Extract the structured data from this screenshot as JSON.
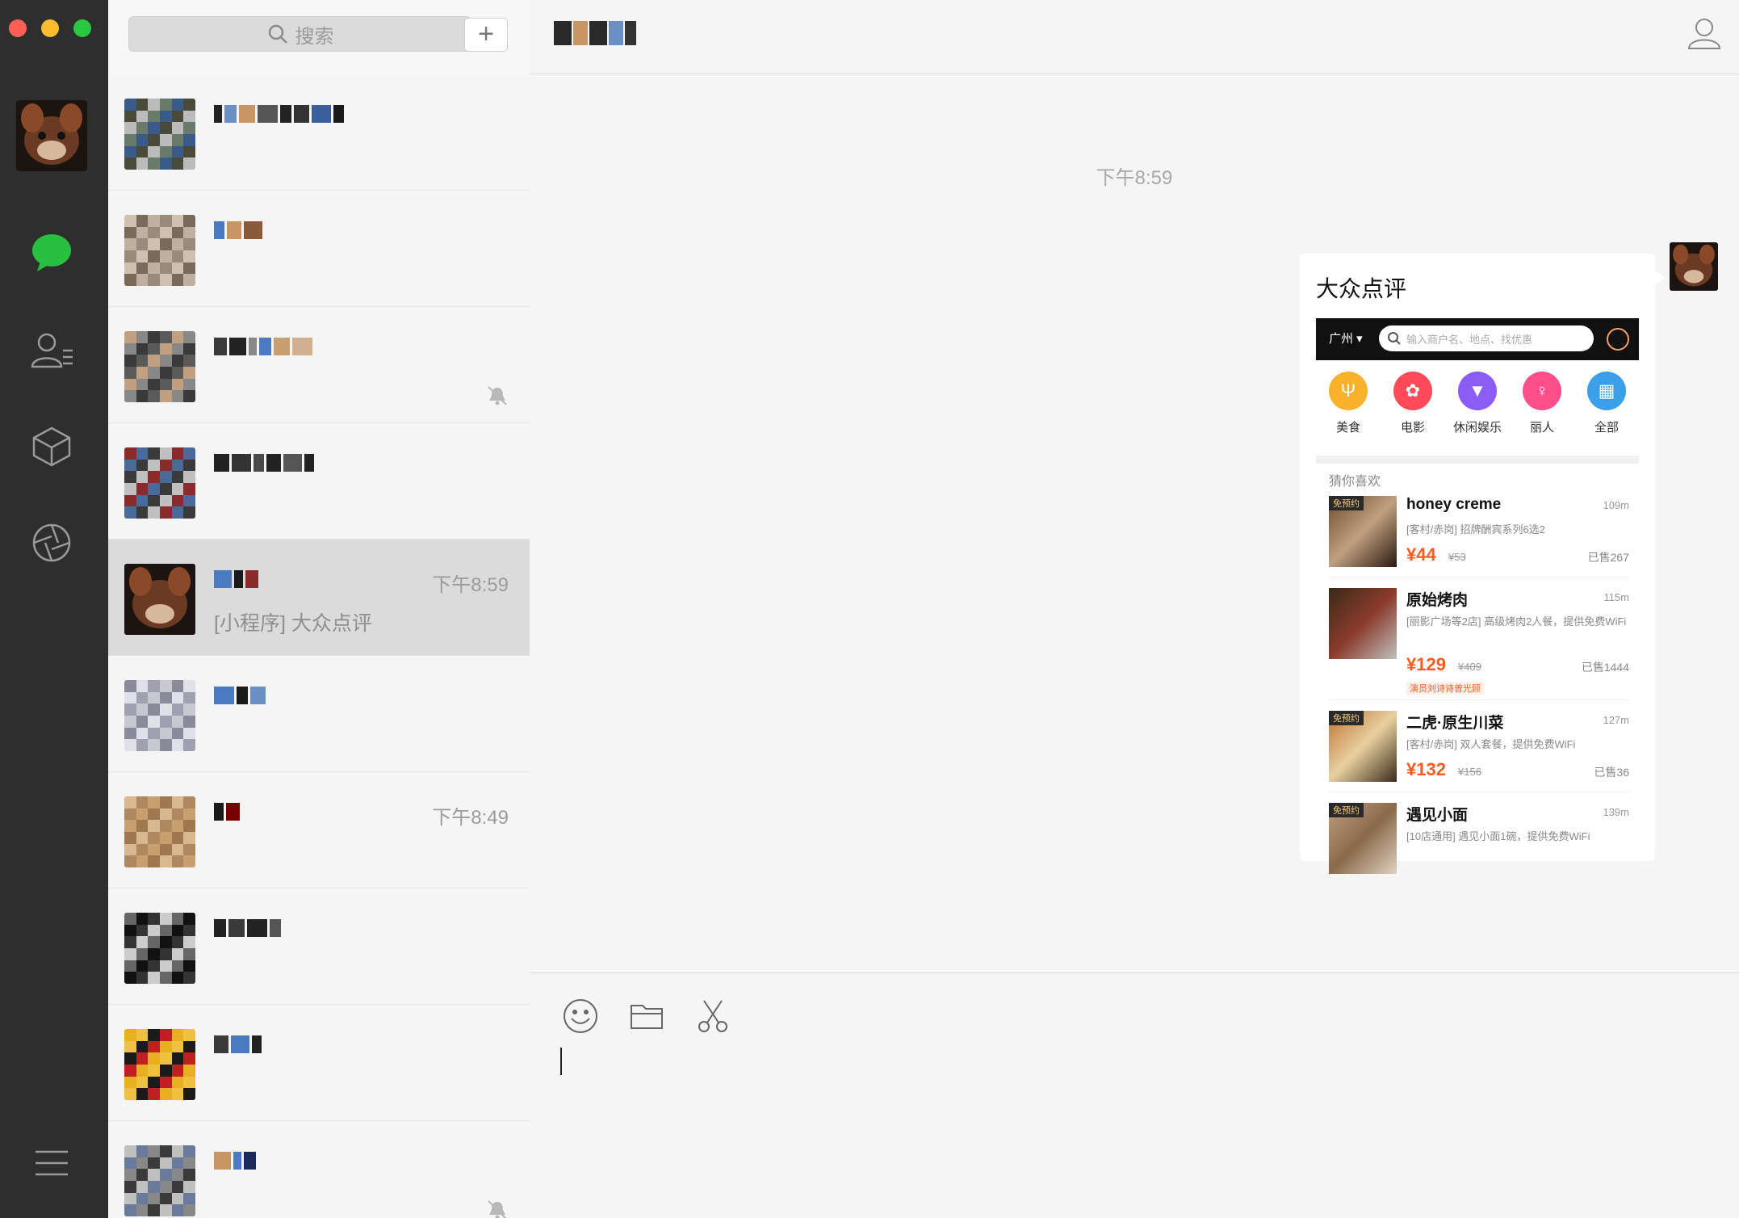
{
  "window": {
    "traffic_lights": [
      "close",
      "minimize",
      "zoom"
    ]
  },
  "rail": {
    "icons": [
      {
        "name": "chat-icon",
        "active": true
      },
      {
        "name": "contacts-icon",
        "active": false
      },
      {
        "name": "favorites-icon",
        "active": false
      },
      {
        "name": "moments-icon",
        "active": false
      },
      {
        "name": "menu-icon",
        "active": false
      }
    ],
    "accent": "#2ac03f"
  },
  "search": {
    "placeholder": "搜索",
    "add_label": "+"
  },
  "chats": [
    {
      "time": "",
      "preview": "",
      "muted": false,
      "active": false
    },
    {
      "time": "",
      "preview": "",
      "muted": false,
      "active": false
    },
    {
      "time": "",
      "preview": "",
      "muted": true,
      "active": false
    },
    {
      "time": "",
      "preview": "",
      "muted": false,
      "active": false
    },
    {
      "time": "下午8:59",
      "preview": "[小程序] 大众点评",
      "muted": false,
      "active": true
    },
    {
      "time": "",
      "preview": "",
      "muted": false,
      "active": false
    },
    {
      "time": "下午8:49",
      "preview": "",
      "muted": false,
      "active": false
    },
    {
      "time": "",
      "preview": "",
      "muted": false,
      "active": false
    },
    {
      "time": "",
      "preview": "",
      "muted": false,
      "active": false
    },
    {
      "time": "",
      "preview": "",
      "muted": true,
      "active": false
    }
  ],
  "conversation": {
    "timestamp": "下午8:59",
    "card": {
      "title": "大众点评",
      "city": "广州",
      "search_placeholder": "输入商户名、地点、找优惠",
      "categories": [
        {
          "label": "美食",
          "color": "#fbb12c",
          "icon": "fork-knife-icon"
        },
        {
          "label": "电影",
          "color": "#ff4a5a",
          "icon": "film-reel-icon"
        },
        {
          "label": "休闲娱乐",
          "color": "#8b5cf6",
          "icon": "cocktail-icon"
        },
        {
          "label": "丽人",
          "color": "#ff4f8a",
          "icon": "lady-icon"
        },
        {
          "label": "全部",
          "color": "#3ba0e8",
          "icon": "grid-icon"
        }
      ],
      "section_label": "猜你喜欢",
      "deals": [
        {
          "badge": "免预约",
          "name": "honey creme",
          "distance": "109m",
          "desc": "[客村/赤岗] 招牌酬宾系列6选2",
          "price": "¥44",
          "original": "¥53",
          "sold": "已售267",
          "tag": ""
        },
        {
          "badge": "",
          "name": "原始烤肉",
          "distance": "115m",
          "desc": "[丽影广场等2店] 高级烤肉2人餐，提供免费WiFi",
          "price": "¥129",
          "original": "¥409",
          "sold": "已售1444",
          "tag": "演员刘诗诗曾光顾"
        },
        {
          "badge": "免预约",
          "name": "二虎·原生川菜",
          "distance": "127m",
          "desc": "[客村/赤岗] 双人套餐，提供免费WiFi",
          "price": "¥132",
          "original": "¥156",
          "sold": "已售36",
          "tag": ""
        },
        {
          "badge": "免预约",
          "name": "遇见小面",
          "distance": "139m",
          "desc": "[10店通用] 遇见小面1碗，提供免费WiFi",
          "price": "",
          "original": "",
          "sold": "",
          "tag": ""
        }
      ]
    }
  },
  "input": {
    "tools": [
      "emoji-icon",
      "folder-icon",
      "scissors-icon"
    ],
    "value": ""
  },
  "colors": {
    "price": "#ff5a1f",
    "card_header": "#111111",
    "timestamp": "#a8a8a8"
  }
}
